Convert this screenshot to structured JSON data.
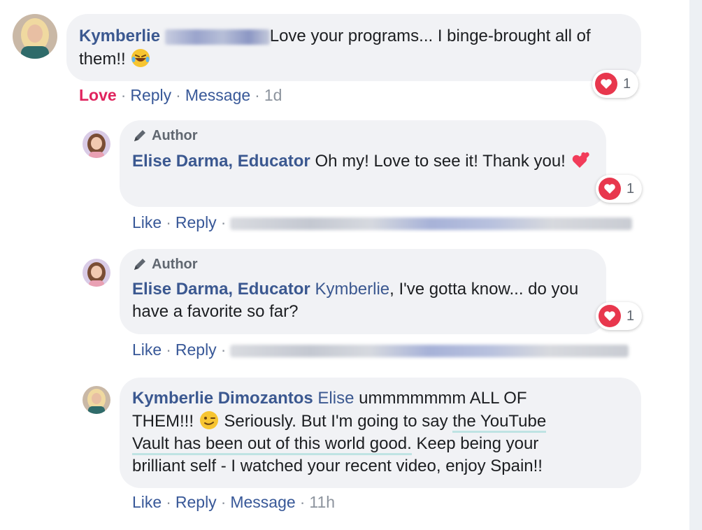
{
  "comments": [
    {
      "author": "Kymberlie",
      "text": "Love your programs... I binge-brought all of them!!",
      "actions": {
        "love": "Love",
        "reply": "Reply",
        "message": "Message",
        "time": "1d"
      },
      "reaction_count": "1"
    },
    {
      "badge": "Author",
      "author": "Elise Darma, Educator",
      "text": "Oh my! Love to see it! Thank you!",
      "actions": {
        "like": "Like",
        "reply": "Reply"
      },
      "reaction_count": "1"
    },
    {
      "badge": "Author",
      "author": "Elise Darma, Educator",
      "mention": "Kymberlie",
      "text": ", I've gotta know... do you have a favorite so far?",
      "actions": {
        "like": "Like",
        "reply": "Reply"
      },
      "reaction_count": "1"
    },
    {
      "author": "Kymberlie Dimozantos",
      "mention": "Elise",
      "text_line1": "ummmmmmm ALL OF",
      "text_line2a": "THEM!!!",
      "text_line2b": "Seriously. But I'm going to say",
      "text_hl1": "the YouTube",
      "text_hl2": "Vault has been out of this world good.",
      "text_line3b": "Keep being your",
      "text_line4": "brilliant self - I watched your recent video, enjoy Spain!!",
      "actions": {
        "like": "Like",
        "reply": "Reply",
        "message": "Message",
        "time": "11h"
      }
    }
  ],
  "colors": {
    "name": "#3b5890",
    "love": "#e0245e",
    "bubble": "#f1f2f5",
    "heart": "#e8374d"
  },
  "icons": [
    "avatar-kymberlie",
    "avatar-elise",
    "pencil-icon",
    "heart-reaction-icon",
    "laughing-emoji-icon",
    "two-hearts-emoji-icon",
    "winking-emoji-icon"
  ]
}
